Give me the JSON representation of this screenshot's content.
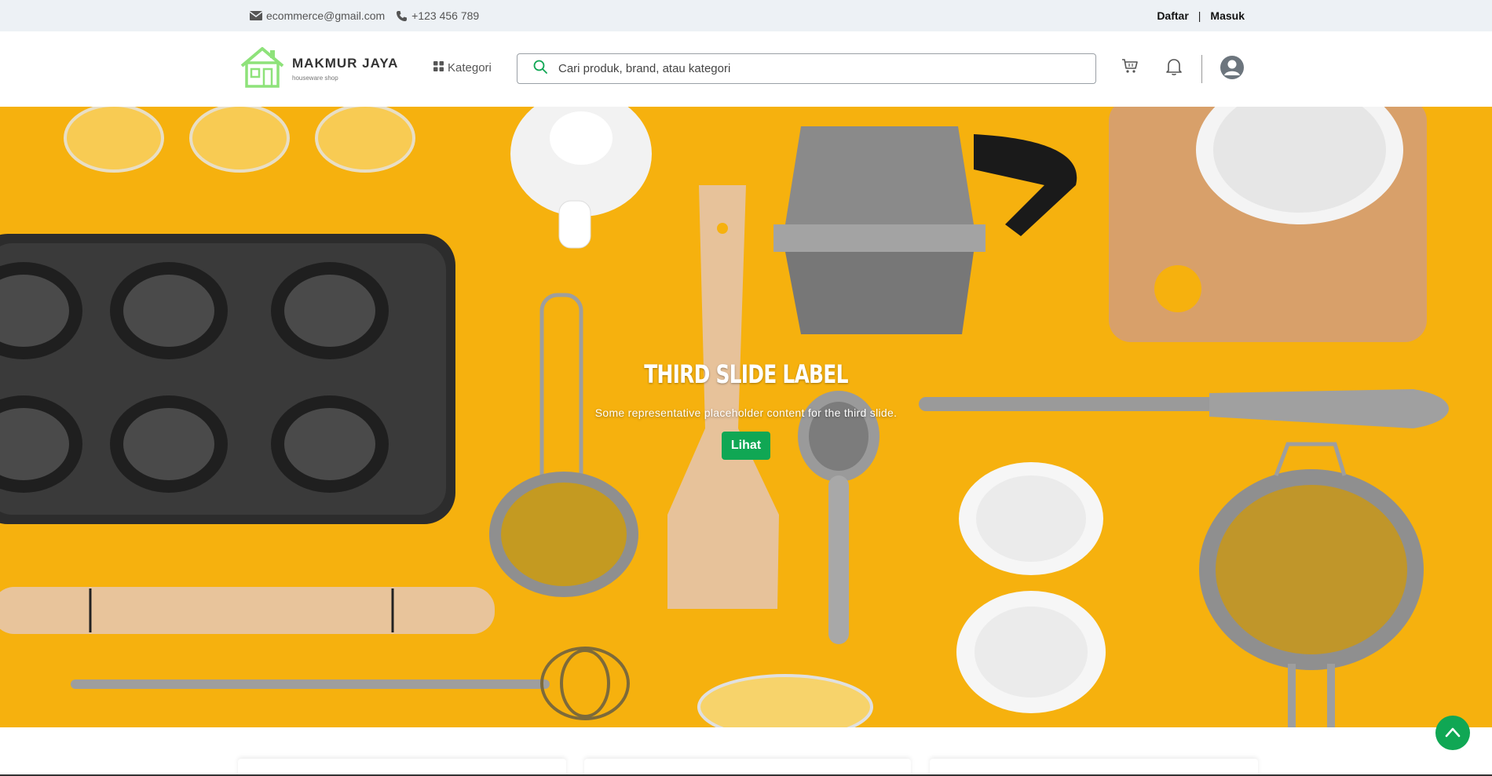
{
  "topbar": {
    "email": "ecommerce@gmail.com",
    "phone": "+123 456 789",
    "register_label": "Daftar",
    "separator": "|",
    "login_label": "Masuk"
  },
  "header": {
    "logo_title": "MAKMUR JAYA",
    "logo_subtitle": "houseware shop",
    "category_label": "Kategori",
    "search_placeholder": "Cari produk, brand, atau kategori",
    "icons": [
      "cart-icon",
      "bell-icon",
      "user-avatar-icon"
    ]
  },
  "hero": {
    "title": "THIRD SLIDE LABEL",
    "text": "Some representative placeholder content for the third slide.",
    "button_label": "Lihat"
  },
  "colors": {
    "accent": "#10a754",
    "topbar_bg": "#edf1f5",
    "hero_bg": "#f6b10e",
    "logo_green": "#8ee27a"
  }
}
